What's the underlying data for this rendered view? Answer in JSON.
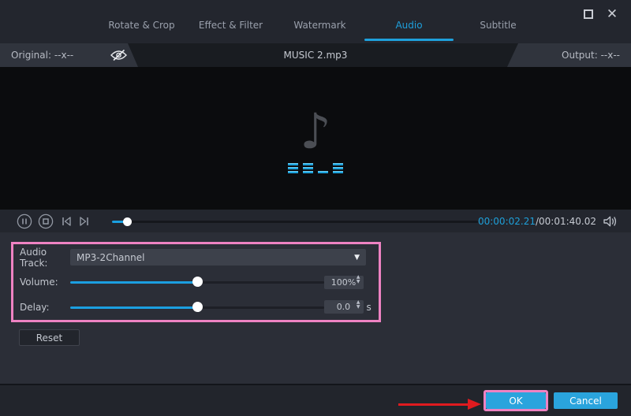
{
  "tabs": {
    "items": [
      {
        "label": "Rotate & Crop",
        "active": false
      },
      {
        "label": "Effect & Filter",
        "active": false
      },
      {
        "label": "Watermark",
        "active": false
      },
      {
        "label": "Audio",
        "active": true
      },
      {
        "label": "Subtitle",
        "active": false
      }
    ]
  },
  "window_controls": {
    "close_glyph": "✕"
  },
  "filebar": {
    "original": "Original: --x--",
    "title": "MUSIC 2.mp3",
    "output": "Output: --x--"
  },
  "preview": {
    "note_glyph": "♪"
  },
  "player": {
    "current_time": "00:00:02.21",
    "separator": "/",
    "total_time": "00:01:40.02",
    "progress_percent": 4
  },
  "panel": {
    "audio_track_label": "Audio Track:",
    "audio_track_value": "MP3-2Channel",
    "dropdown_arrow": "▼",
    "volume_label": "Volume:",
    "volume_value": "100%",
    "volume_percent": 50,
    "delay_label": "Delay:",
    "delay_value": "0.0",
    "delay_unit": "s",
    "delay_percent": 50,
    "spin_up": "▲",
    "spin_down": "▼"
  },
  "actions": {
    "reset": "Reset",
    "ok": "OK",
    "cancel": "Cancel"
  },
  "colors": {
    "accent_blue": "#1ea0dc",
    "highlight_pink": "#ee82c2",
    "annotation_red": "#e01b1f",
    "slider_blue": "#1b9fe0"
  }
}
